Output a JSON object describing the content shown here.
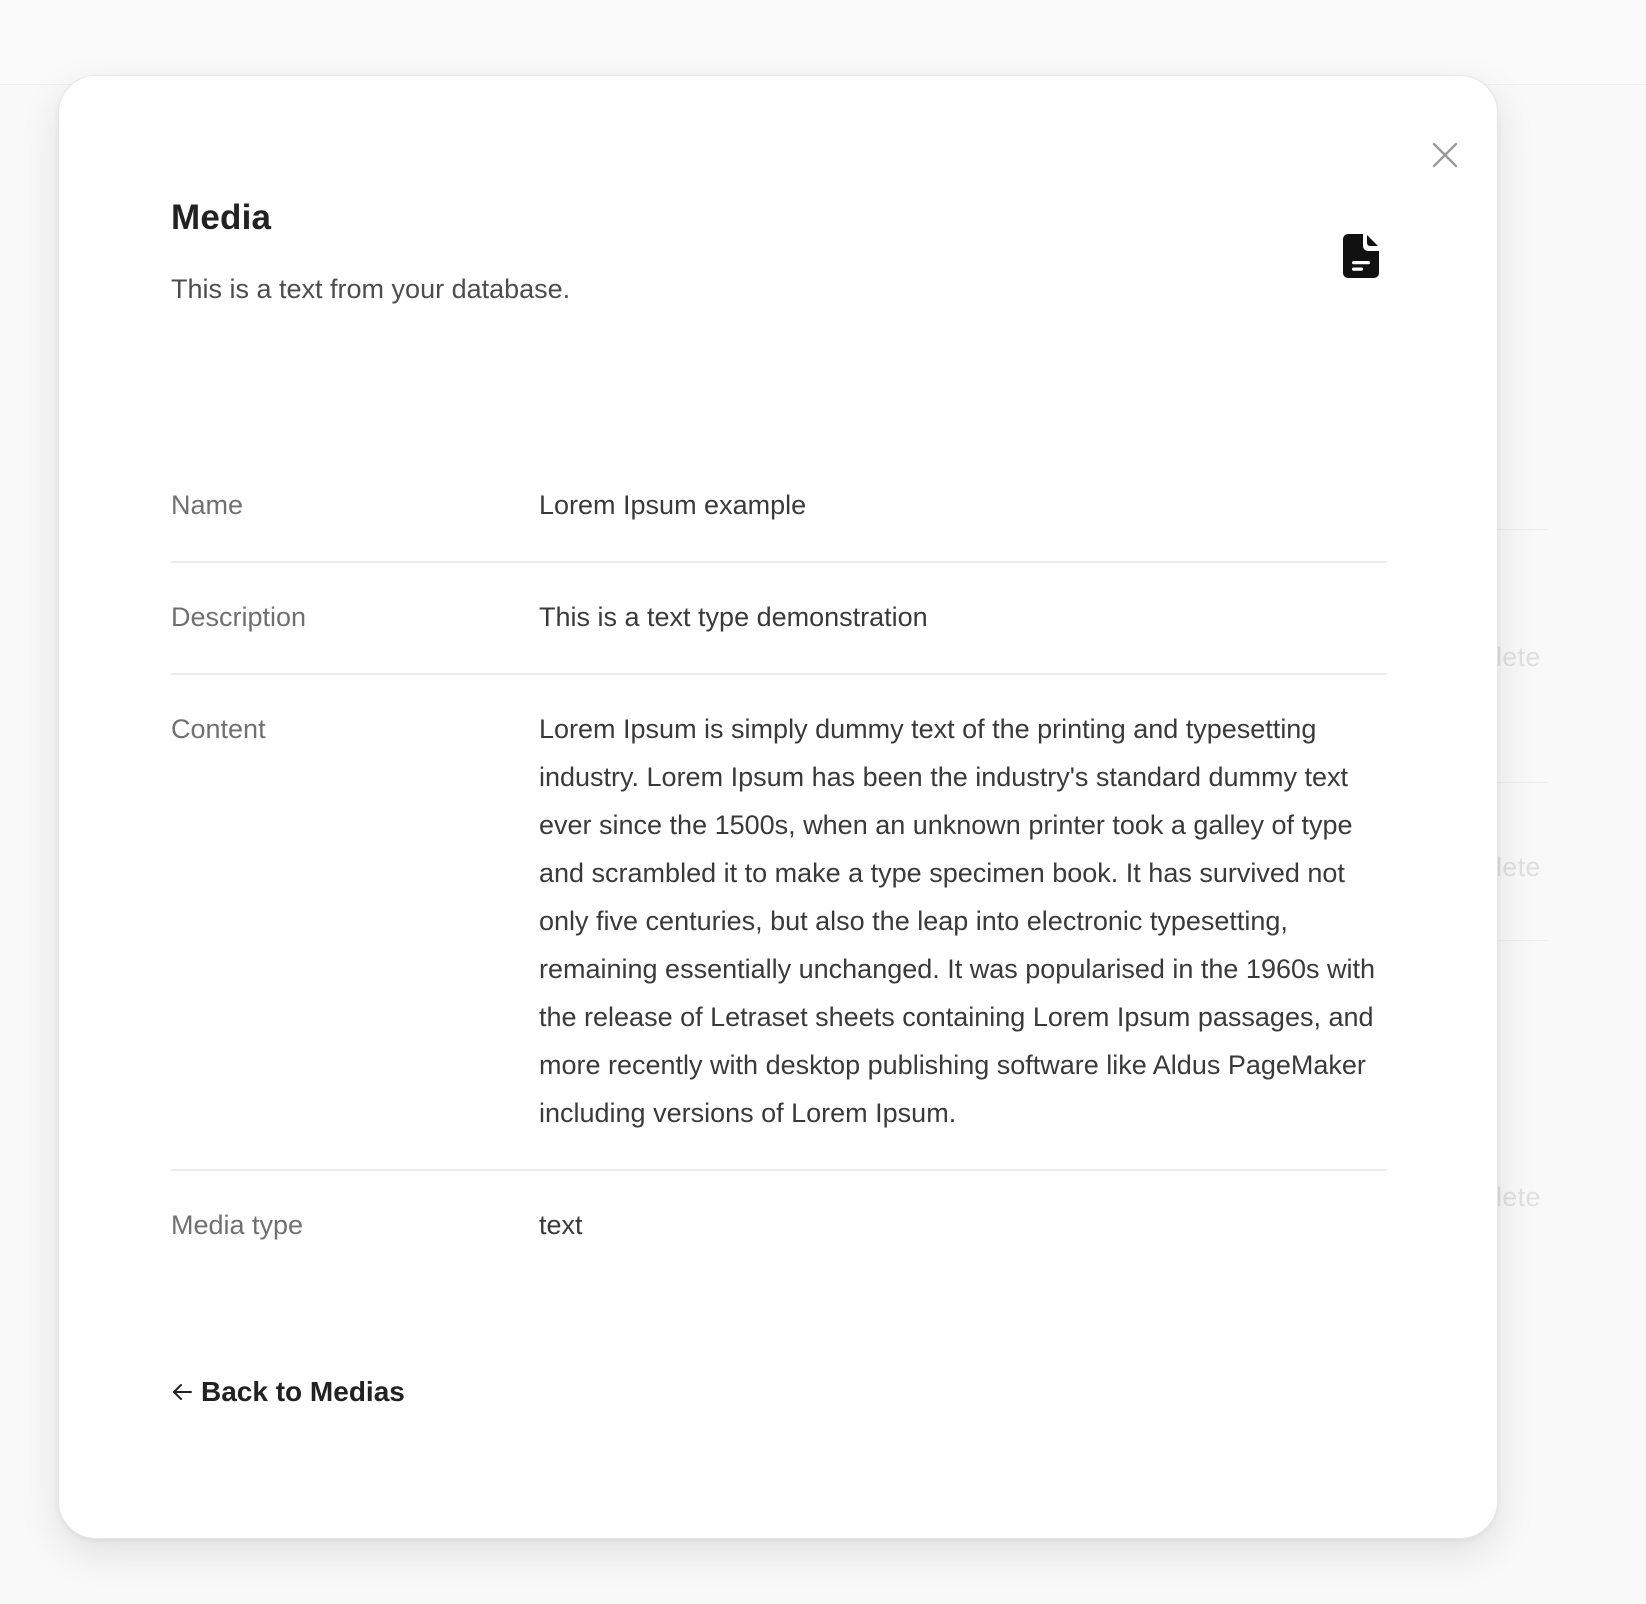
{
  "background": {
    "delete_label_partial": "lete"
  },
  "modal": {
    "title": "Media",
    "subtitle": "This is a text from your database.",
    "close_icon": "close-icon",
    "type_icon": "document-text-icon",
    "fields": [
      {
        "label": "Name",
        "value": "Lorem Ipsum example"
      },
      {
        "label": "Description",
        "value": "This is a text type demonstration"
      },
      {
        "label": "Content",
        "value": "Lorem Ipsum is simply dummy text of the printing and typesetting industry. Lorem Ipsum has been the industry's standard dummy text ever since the 1500s, when an unknown printer took a galley of type and scrambled it to make a type specimen book. It has survived not only five centuries, but also the leap into electronic typesetting, remaining essentially unchanged. It was popularised in the 1960s with the release of Letraset sheets containing Lorem Ipsum passages, and more recently with desktop publishing software like Aldus PageMaker including versions of Lorem Ipsum."
      },
      {
        "label": "Media type",
        "value": "text"
      }
    ],
    "back_link": {
      "arrow": "←",
      "label": "Back to Medias"
    }
  }
}
